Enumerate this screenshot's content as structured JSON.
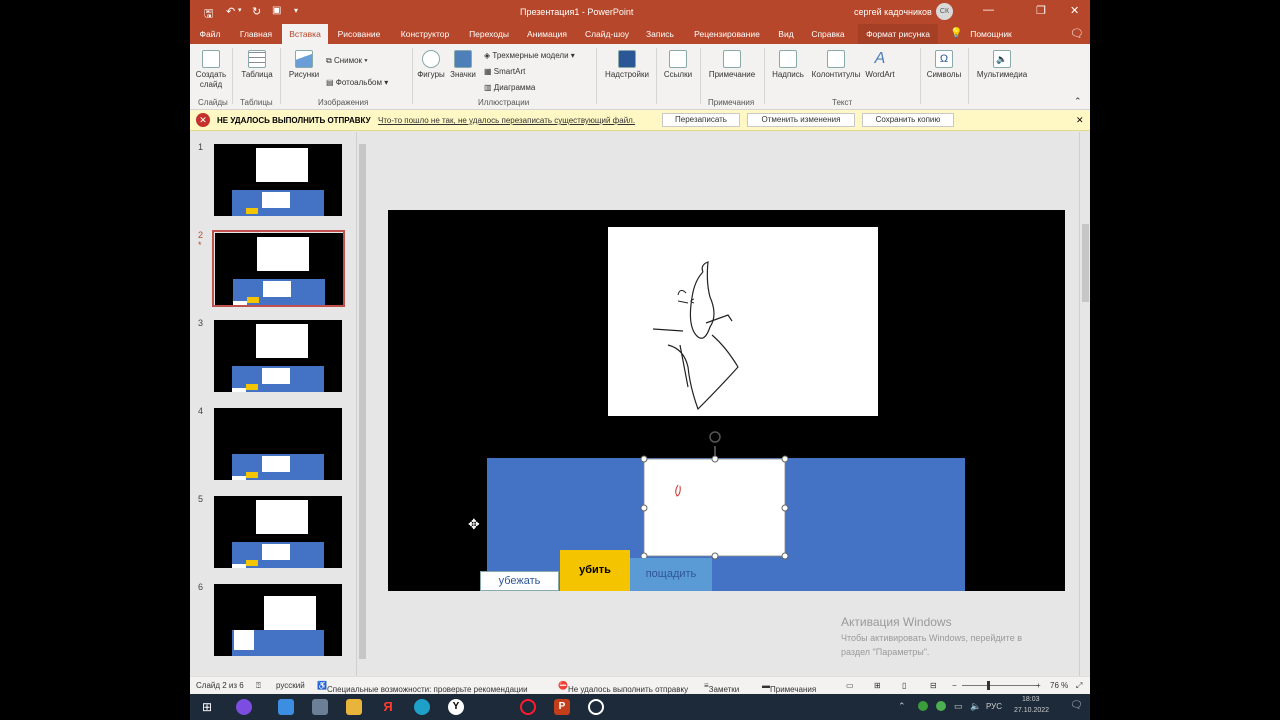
{
  "window": {
    "title": "Презентация1 - PowerPoint",
    "user": "сергей кадочников",
    "user_initials": "СК",
    "controls": [
      "—",
      "❐",
      "✕"
    ]
  },
  "tabs": [
    "Файл",
    "Главная",
    "Вставка",
    "Рисование",
    "Конструктор",
    "Переходы",
    "Анимация",
    "Слайд-шоу",
    "Запись",
    "Рецензирование",
    "Вид",
    "Справка",
    "Формат рисунка",
    "Помощник"
  ],
  "ribbon": {
    "create_slide": "Создать слайд",
    "table": "Таблица",
    "pictures": "Рисунки",
    "snapshot": "Снимок",
    "photo_album": "Фотоальбом",
    "shapes": "Фигуры",
    "icons": "Значки",
    "models3d": "Трехмерные модели",
    "smartart": "SmartArt",
    "chart": "Диаграмма",
    "addins": "Надстройки",
    "links": "Ссылки",
    "comment": "Примечание",
    "textbox": "Надпись",
    "header_footer": "Колонтитулы",
    "wordart": "WordArt",
    "symbols": "Символы",
    "media": "Мультимедиа",
    "groups": {
      "slides": "Слайды",
      "tables": "Таблицы",
      "images": "Изображения",
      "illustrations": "Иллюстрации",
      "comments": "Примечания",
      "text": "Текст"
    }
  },
  "message_bar": {
    "title": "НЕ УДАЛОСЬ ВЫПОЛНИТЬ ОТПРАВКУ",
    "text": "Что-то пошло не так, не удалось перезаписать существующий файл.",
    "overwrite": "Перезаписать",
    "discard": "Отменить изменения",
    "save_copy": "Сохранить копию",
    "close": "✕"
  },
  "slides": [
    {
      "number": "1",
      "star": ""
    },
    {
      "number": "2",
      "star": "*"
    },
    {
      "number": "3",
      "star": ""
    },
    {
      "number": "4",
      "star": ""
    },
    {
      "number": "5",
      "star": ""
    },
    {
      "number": "6",
      "star": ""
    }
  ],
  "selected_slide": 2,
  "slide": {
    "btn_run": "убежать",
    "btn_kill": "убить",
    "btn_spare": "пощадить"
  },
  "watermark": {
    "title": "Активация Windows",
    "line1": "Чтобы активировать Windows, перейдите в",
    "line2": "раздел \"Параметры\"."
  },
  "status": {
    "slide_of": "Слайд 2 из 6",
    "language": "русский",
    "accessibility": "Специальные возможности: проверьте рекомендации",
    "send_failed": "Не удалось выполнить отправку",
    "notes": "Заметки",
    "comments": "Примечания",
    "zoom": "76 %"
  },
  "taskbar": {
    "lang": "РУС",
    "time": "18:03",
    "date": "27.10.2022"
  },
  "colors": {
    "accent": "#b7472a",
    "slide_blue": "#4472c4",
    "kill_yellow": "#f5c400",
    "spare_blue": "#5b9bd5"
  }
}
